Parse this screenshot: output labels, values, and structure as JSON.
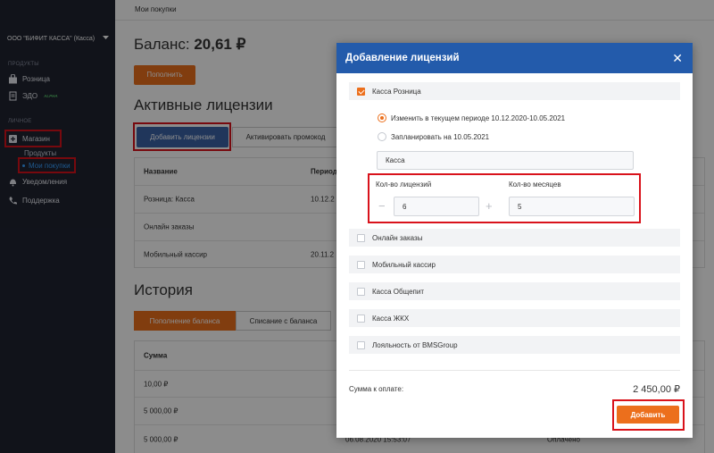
{
  "sidebar": {
    "org": "ООО \"БИФИТ КАССА\" (Касса)",
    "section_products": "ПРОДУКТЫ",
    "item_retail": "Розница",
    "item_edo": "ЭДО",
    "edo_badge": "ALPHA",
    "section_personal": "ЛИЧНОЕ",
    "item_shop": "Магазин",
    "sub_products": "Продукты",
    "sub_my_purchases": "Мои покупки",
    "item_notifications": "Уведомления",
    "item_support": "Поддержка"
  },
  "main": {
    "breadcrumb": "Мои покупки",
    "balance_label": "Баланс:",
    "balance_value": "20,61 ₽",
    "topup_button": "Пополнить",
    "active_title": "Активные лицензии",
    "add_license_button": "Добавить лицензии",
    "activate_promo_button": "Активировать промокод",
    "licenses_table": {
      "headers": [
        "Название",
        "Период"
      ],
      "rows": [
        [
          "Розница: Касса",
          "10.12.2"
        ],
        [
          "Онлайн заказы",
          ""
        ],
        [
          "Мобильный кассир",
          "20.11.2"
        ]
      ]
    },
    "history_title": "История",
    "tab_topup": "Пополнение баланса",
    "tab_writeoff": "Списание с баланса",
    "history_table": {
      "header": "Сумма",
      "rows": [
        {
          "amount": "10,00 ₽",
          "date": "",
          "status": ""
        },
        {
          "amount": "5 000,00 ₽",
          "date": "",
          "status": ""
        },
        {
          "amount": "5 000,00 ₽",
          "date": "06.08.2020 15:53:07",
          "status": "Оплачено"
        }
      ]
    }
  },
  "modal": {
    "title": "Добавление лицензий",
    "option_retail": "Касса Розница",
    "radio_change": "Изменить в текущем периоде 10.12.2020-10.05.2021",
    "radio_schedule": "Запланировать на 10.05.2021",
    "select_value": "Касса",
    "label_count": "Кол-во лицензий",
    "label_months": "Кол-во месяцев",
    "count_value": "6",
    "months_value": "5",
    "minus": "−",
    "plus": "+",
    "options": [
      "Онлайн заказы",
      "Мобильный кассир",
      "Касса Общепит",
      "Касса ЖКХ",
      "Лояльность от BMSGroup"
    ],
    "sum_label": "Сумма к оплате:",
    "sum_value": "2 450,00 ₽",
    "add_button": "Добавить"
  },
  "colors": {
    "accent_orange": "#ec6f1c",
    "header_blue": "#235bab",
    "sidebar_bg": "#1f2331",
    "highlight_red": "#d9121b"
  }
}
